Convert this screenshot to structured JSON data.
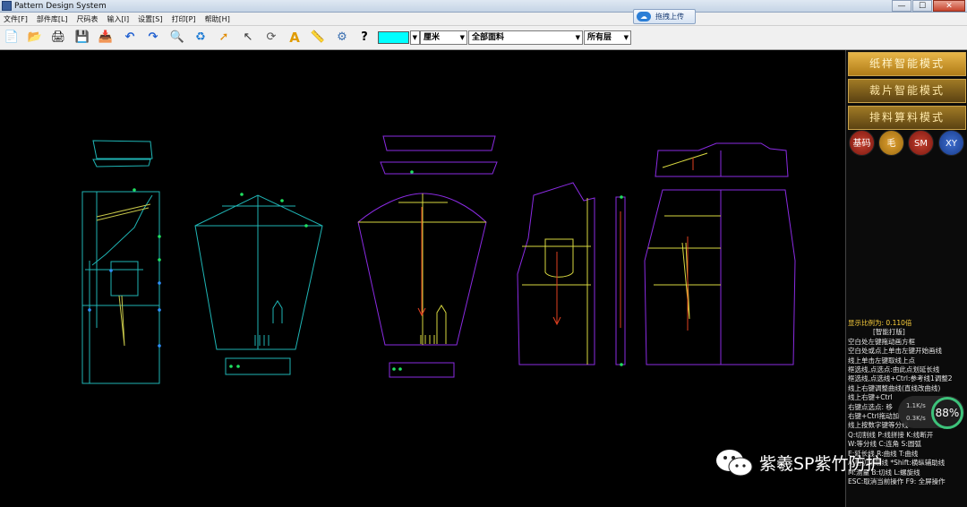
{
  "window": {
    "title": "Pattern Design System",
    "upload_button": "拖拽上传",
    "buttons": {
      "minimize": "—",
      "maximize": "☐",
      "close": "✕"
    }
  },
  "menu": [
    "文件[F]",
    "部件库[L]",
    "尺码表",
    "输入[I]",
    "设置[S]",
    "打印[P]",
    "帮助[H]"
  ],
  "toolbar": {
    "tools": [
      {
        "icon": "new-file-icon",
        "glyph": "📄"
      },
      {
        "icon": "open-folder-icon",
        "glyph": "📂"
      },
      {
        "icon": "print-icon",
        "glyph": "🖨"
      },
      {
        "icon": "save-icon",
        "glyph": "💾"
      },
      {
        "icon": "import-icon",
        "glyph": "📥"
      },
      {
        "icon": "undo-icon",
        "glyph": "↶"
      },
      {
        "icon": "redo-icon",
        "glyph": "↷"
      },
      {
        "icon": "zoom-icon",
        "glyph": "🔍"
      },
      {
        "icon": "refresh-icon",
        "glyph": "♻"
      },
      {
        "icon": "select-arrow-icon",
        "glyph": "➚"
      },
      {
        "icon": "pointer-icon",
        "glyph": "↖"
      },
      {
        "icon": "rotate-icon",
        "glyph": "⟳"
      },
      {
        "icon": "text-icon",
        "glyph": "A"
      },
      {
        "icon": "tape-icon",
        "glyph": "📏"
      },
      {
        "icon": "film-icon",
        "glyph": "⚙"
      },
      {
        "icon": "help-icon",
        "glyph": "?"
      }
    ],
    "color": "#00ffff",
    "unit": "厘米",
    "fabric": "全部面料",
    "layer": "所有层"
  },
  "panel": {
    "modes": [
      "纸样智能模式",
      "裁片智能模式",
      "排料算料模式"
    ],
    "circles": [
      {
        "label": "基码",
        "color": "#8a1a0f"
      },
      {
        "label": "毛",
        "color": "#b67a10"
      },
      {
        "label": "SM",
        "color": "#8b1a14"
      },
      {
        "label": "XY",
        "color": "#1d3f8f"
      }
    ],
    "scale_label": "显示比例为: 0.110倍",
    "info_lines": [
      "[智能打版]",
      "空白处左键拖动画方框",
      "空白处或点上单击左键开始画线",
      "线上单击左键取线上点",
      "框选线,点选点:由此点划延长线",
      "框选线,点选线+Ctrl:参考线1调整2",
      "线上右键调整曲线(直线改曲线)",
      "线上右键+Ctrl",
      "右键点选点: 移",
      "右键+Ctrl拖动加",
      "线上按数字键等分线",
      "Q:切割线  P:线拼接  K:线断开",
      "W:等分线  C:连角  S:圆弧",
      "E:延长线  R:曲线  T:曲线",
      "A:相切辅助线 *Shift:横纵辅助线",
      "M:测量  B:切线  L:螺旋线",
      "ESC:取消当前操作  F9: 全屏操作"
    ]
  },
  "net": {
    "up": "1.1K/s",
    "down": "0.3K/s",
    "percent": "88%"
  },
  "watermark": "紫羲SP紫竹防护"
}
